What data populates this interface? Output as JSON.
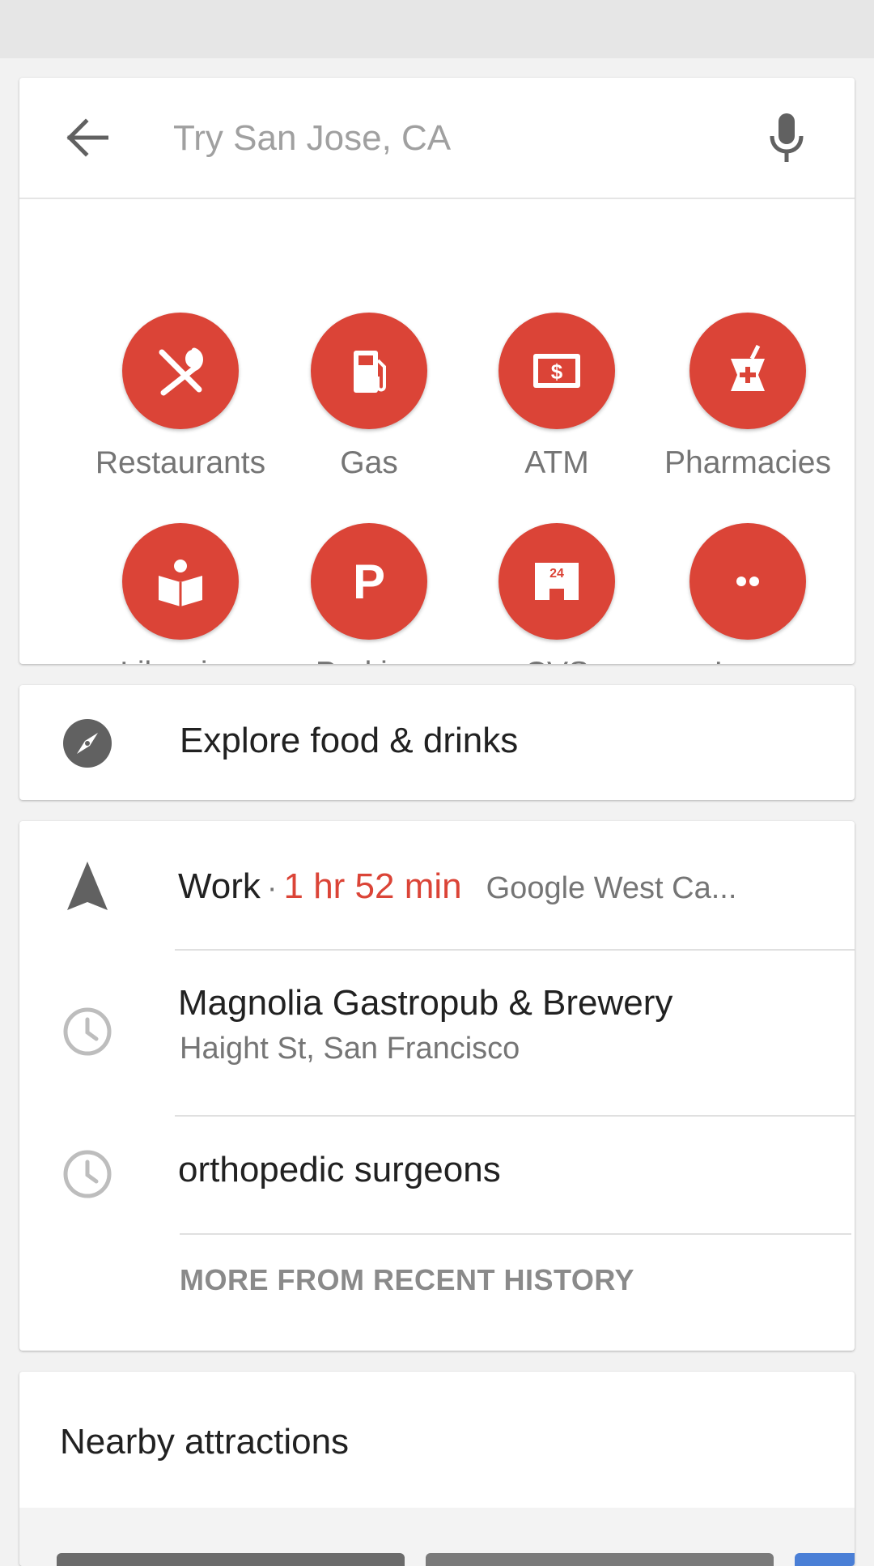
{
  "search": {
    "placeholder": "Try San Jose, CA",
    "back_icon": "arrow-back-icon",
    "mic_icon": "mic-icon"
  },
  "categories": [
    {
      "label": "Restaurants",
      "icon": "restaurant-icon"
    },
    {
      "label": "Gas",
      "icon": "gas-station-icon"
    },
    {
      "label": "ATM",
      "icon": "atm-icon"
    },
    {
      "label": "Pharmacies",
      "icon": "pharmacy-icon"
    },
    {
      "label": "Libraries",
      "icon": "library-icon"
    },
    {
      "label": "Parking",
      "icon": "parking-icon"
    },
    {
      "label": "CVS",
      "icon": "store-24h-icon"
    },
    {
      "label": "Less",
      "icon": "more-dots-icon"
    }
  ],
  "explore": {
    "label": "Explore food & drinks",
    "icon": "compass-icon"
  },
  "history": {
    "work": {
      "title": "Work",
      "separator": "·",
      "eta": "1 hr 52 min",
      "destination": "Google West Ca...",
      "icon": "navigation-arrow-icon"
    },
    "items": [
      {
        "title": "Magnolia Gastropub & Brewery",
        "subtitle": "Haight St, San Francisco",
        "icon": "history-clock-icon"
      },
      {
        "title": "orthopedic surgeons",
        "icon": "history-clock-icon"
      }
    ],
    "more_label": "MORE FROM RECENT HISTORY"
  },
  "nearby": {
    "title": "Nearby attractions"
  },
  "colors": {
    "accent": "#db4437",
    "background": "#f2f2f2",
    "card": "#ffffff"
  }
}
